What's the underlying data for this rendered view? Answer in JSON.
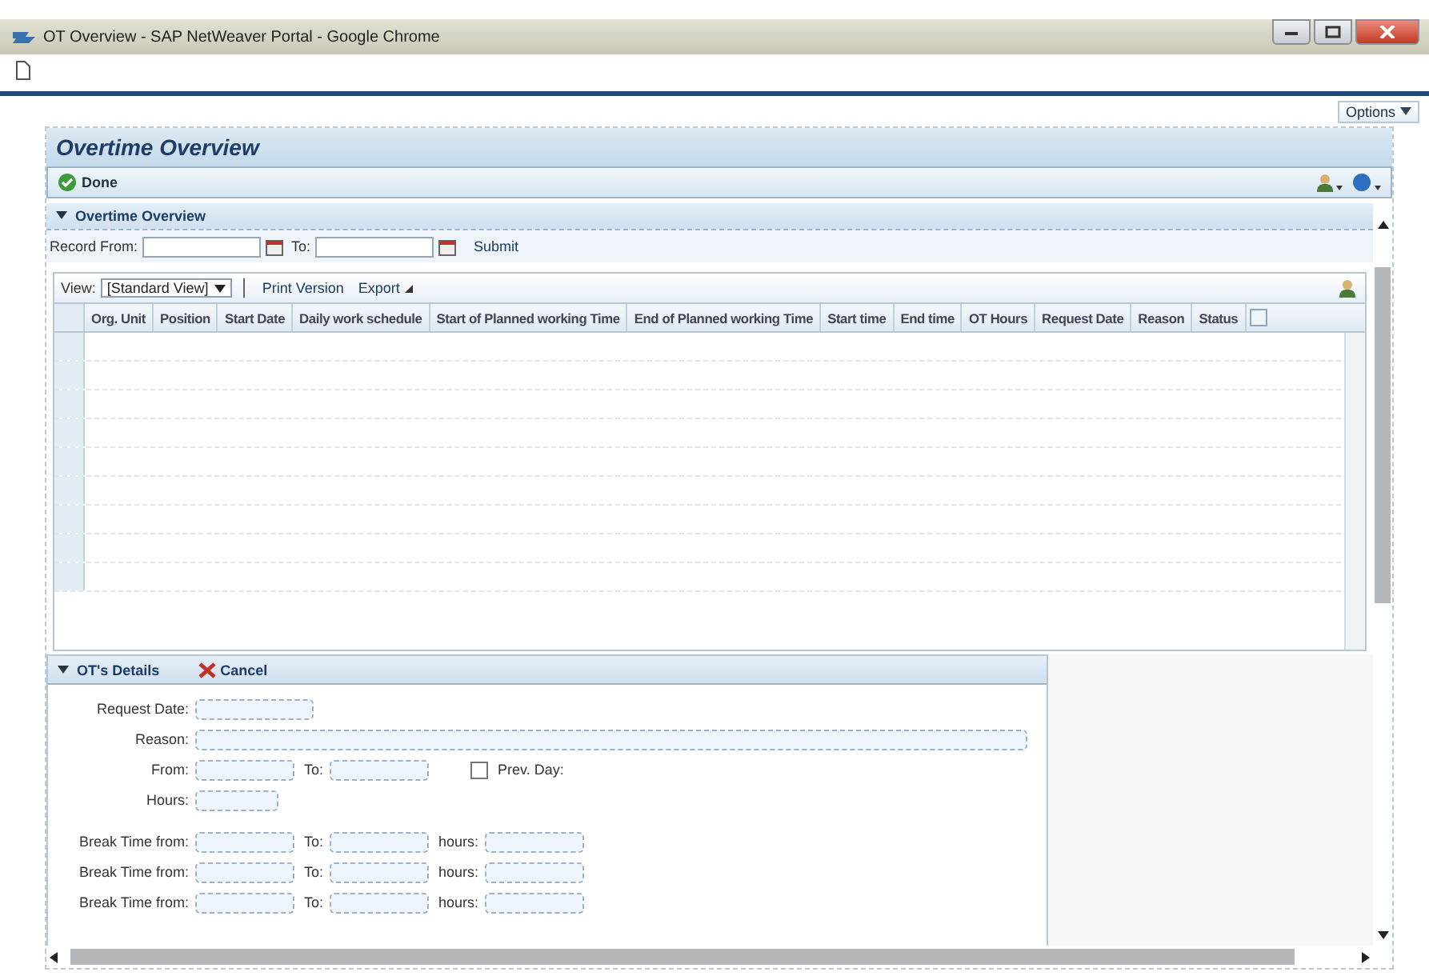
{
  "window": {
    "title": "OT Overview - SAP NetWeaver Portal - Google Chrome"
  },
  "options_button": "Options",
  "page_title": "Overtime Overview",
  "toolbar": {
    "done": "Done"
  },
  "overview_section": {
    "title": "Overtime Overview",
    "expanded": true,
    "record_from_label": "Record From:",
    "to_label": "To:",
    "submit": "Submit"
  },
  "table": {
    "view_label": "View:",
    "view_value": "[Standard View]",
    "print": "Print Version",
    "export": "Export",
    "columns": [
      "Org. Unit",
      "Position",
      "Start Date",
      "Daily work schedule",
      "Start of Planned working Time",
      "End of Planned working Time",
      "Start time",
      "End time",
      "OT Hours",
      "Request Date",
      "Reason",
      "Status"
    ]
  },
  "details": {
    "title": "OT's Details",
    "expanded": true,
    "cancel": "Cancel",
    "request_date_label": "Request Date:",
    "reason_label": "Reason:",
    "from_label": "From:",
    "to_label": "To:",
    "prev_day": {
      "label": "Prev. Day:",
      "checked": false
    },
    "hours_label": "Hours:",
    "breaks": [
      {
        "from_label": "Break Time from:",
        "to_label": "To:",
        "hours_label": "hours:"
      },
      {
        "from_label": "Break Time from:",
        "to_label": "To:",
        "hours_label": "hours:"
      },
      {
        "from_label": "Break Time from:",
        "to_label": "To:",
        "hours_label": "hours:"
      }
    ]
  }
}
